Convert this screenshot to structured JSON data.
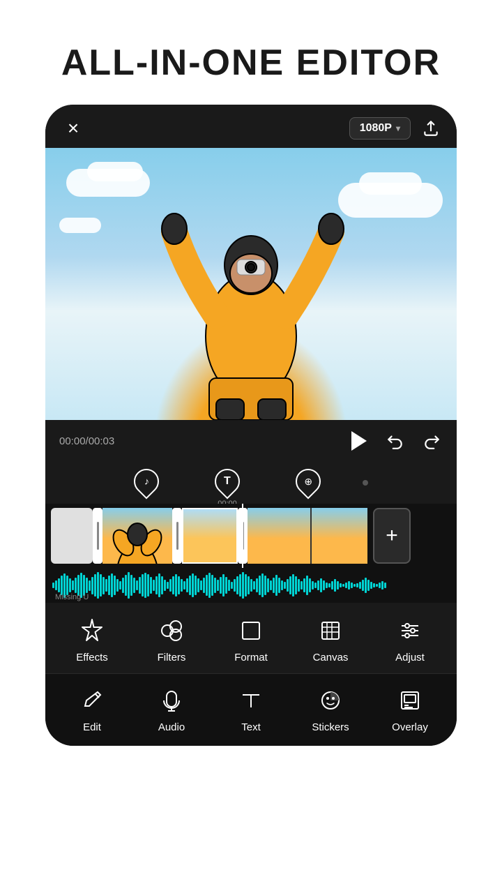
{
  "page": {
    "title": "ALL-IN-ONE EDITOR"
  },
  "topbar": {
    "close_label": "×",
    "resolution": "1080P",
    "resolution_chevron": "▾"
  },
  "playback": {
    "time_current": "00:00",
    "time_total": "00:03",
    "time_display": "00:00/00:03"
  },
  "timeline": {
    "waveform_label": "Missing U"
  },
  "markers": [
    {
      "icon": "♪",
      "time": ""
    },
    {
      "icon": "T",
      "time": "00:00"
    },
    {
      "icon": "⊕",
      "time": ""
    }
  ],
  "main_tools": [
    {
      "id": "effects",
      "label": "Effects"
    },
    {
      "id": "filters",
      "label": "Filters"
    },
    {
      "id": "format",
      "label": "Format"
    },
    {
      "id": "canvas",
      "label": "Canvas"
    },
    {
      "id": "adjust",
      "label": "Adjust"
    }
  ],
  "secondary_tools": [
    {
      "id": "edit",
      "label": "Edit"
    },
    {
      "id": "audio",
      "label": "Audio"
    },
    {
      "id": "text",
      "label": "Text"
    },
    {
      "id": "stickers",
      "label": "Stickers"
    },
    {
      "id": "overlay",
      "label": "Overlay"
    }
  ]
}
